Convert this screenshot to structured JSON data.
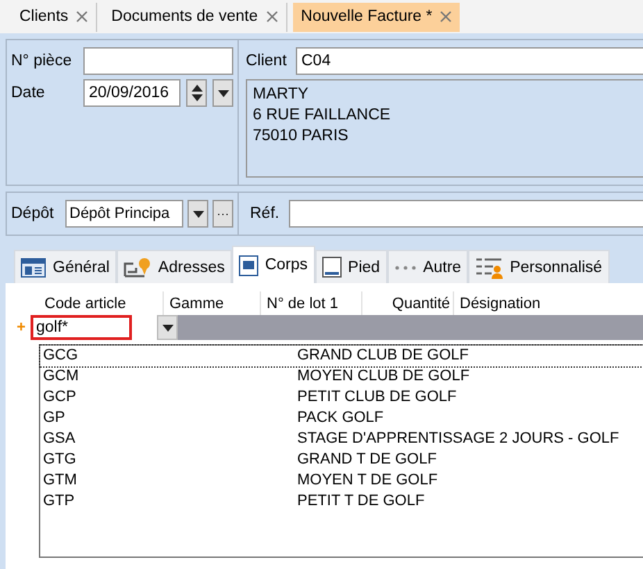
{
  "doc_tabs": [
    {
      "label": "Clients",
      "selected": false
    },
    {
      "label": "Documents de vente",
      "selected": false
    },
    {
      "label": "Nouvelle Facture *",
      "selected": true
    }
  ],
  "header": {
    "piece_label": "N° pièce",
    "date_label": "Date",
    "date_value": "20/09/2016",
    "client_label": "Client",
    "client_value": "C04",
    "address": [
      "MARTY",
      "6 RUE FAILLANCE",
      "75010 PARIS"
    ],
    "depot_label": "Dépôt",
    "depot_value": "Dépôt Principa",
    "depot_more": "···",
    "ref_label": "Réf."
  },
  "section_tabs": [
    {
      "label": "Général",
      "kind": "general",
      "selected": false
    },
    {
      "label": "Adresses",
      "kind": "adresses",
      "selected": false
    },
    {
      "label": "Corps",
      "kind": "corps",
      "selected": true
    },
    {
      "label": "Pied",
      "kind": "pied",
      "selected": false
    },
    {
      "label": "Autre",
      "kind": "autre",
      "selected": false
    },
    {
      "label": "Personnalisé",
      "kind": "perso",
      "selected": false
    }
  ],
  "grid": {
    "columns": [
      "Code article",
      "Gamme",
      "N° de lot 1",
      "Quantité",
      "Désignation"
    ],
    "new_row_marker": "+",
    "input_value": "golf*"
  },
  "suggestions": [
    {
      "code": "GCG",
      "label": "GRAND CLUB DE GOLF",
      "selected": true
    },
    {
      "code": "GCM",
      "label": "MOYEN CLUB DE GOLF",
      "selected": false
    },
    {
      "code": "GCP",
      "label": "PETIT CLUB DE GOLF",
      "selected": false
    },
    {
      "code": "GP",
      "label": "PACK GOLF",
      "selected": false
    },
    {
      "code": "GSA",
      "label": "STAGE D'APPRENTISSAGE 2 JOURS - GOLF",
      "selected": false
    },
    {
      "code": "GTG",
      "label": "GRAND T DE GOLF",
      "selected": false
    },
    {
      "code": "GTM",
      "label": "MOYEN T DE GOLF",
      "selected": false
    },
    {
      "code": "GTP",
      "label": "PETIT T DE GOLF",
      "selected": false
    }
  ]
}
